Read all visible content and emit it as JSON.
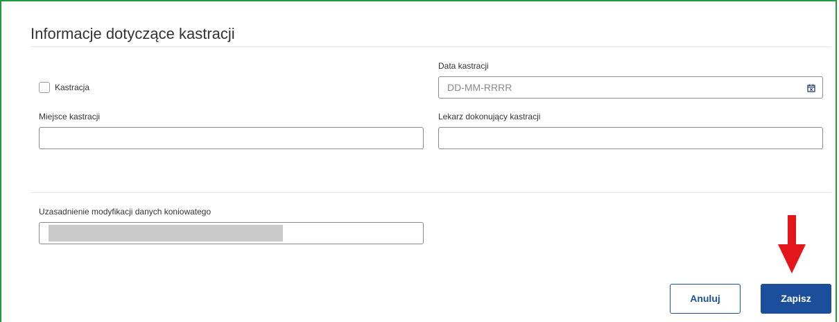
{
  "section": {
    "title": "Informacje dotyczące kastracji"
  },
  "castration_checkbox": {
    "label": "Kastracja",
    "checked": false
  },
  "castration_date": {
    "label": "Data kastracji",
    "placeholder": "DD-MM-RRRR",
    "value": ""
  },
  "castration_place": {
    "label": "Miejsce kastracji",
    "value": ""
  },
  "castration_vet": {
    "label": "Lekarz dokonujący kastracji",
    "value": ""
  },
  "modification_reason": {
    "label": "Uzasadnienie modyfikacji danych koniowatego"
  },
  "actions": {
    "cancel_label": "Anuluj",
    "save_label": "Zapisz"
  },
  "colors": {
    "primary": "#1b4f9c",
    "frame": "#1e9e3a",
    "annotation_arrow": "#e2161b"
  }
}
